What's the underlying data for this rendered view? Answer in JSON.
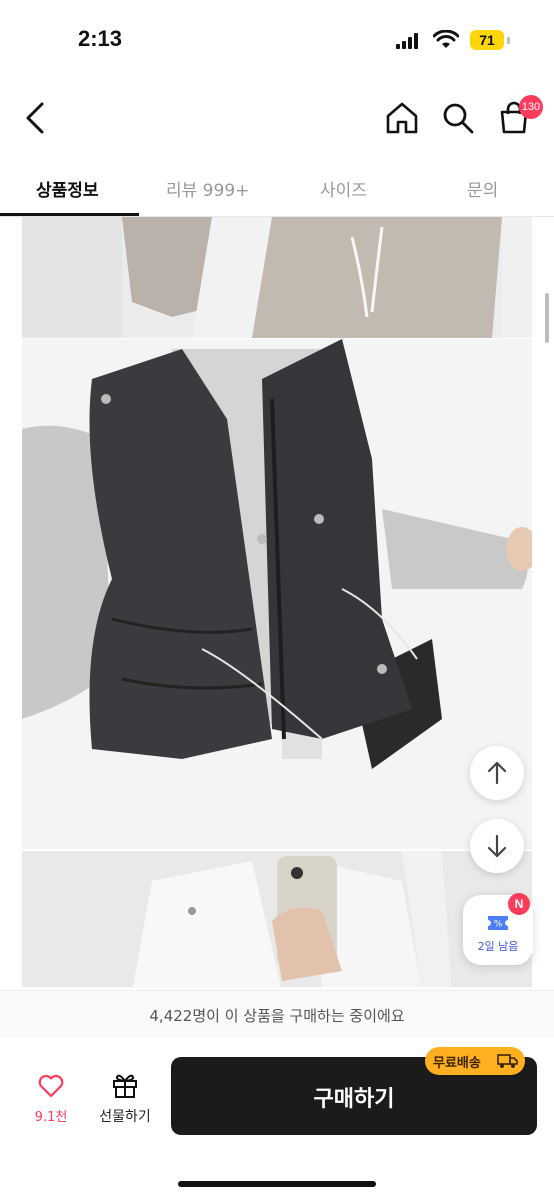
{
  "status_bar": {
    "time": "2:13",
    "battery": "71"
  },
  "nav": {
    "cart_count": "130"
  },
  "tabs": [
    {
      "label": "상품정보",
      "active": true
    },
    {
      "label": "리뷰 999+",
      "active": false
    },
    {
      "label": "사이즈",
      "active": false
    },
    {
      "label": "문의",
      "active": false
    }
  ],
  "coupon": {
    "label": "2일 남음",
    "badge": "N"
  },
  "buyers_notice": "4,422명이 이 상품을 구매하는 중이에요",
  "bottom": {
    "like_count": "9.1천",
    "gift_label": "선물하기",
    "buy_label": "구매하기",
    "shipping_badge": "무료배송"
  },
  "colors": {
    "accent": "#ff3b5c",
    "buy_button": "#1b1b1b",
    "shipping_badge": "#ffb020"
  }
}
